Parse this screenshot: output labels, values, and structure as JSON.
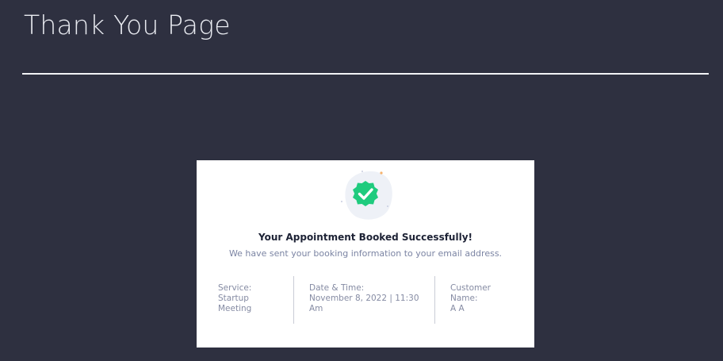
{
  "header": {
    "title": "Thank You Page"
  },
  "confirmation": {
    "icon": "check-badge-icon",
    "heading": "Your Appointment Booked Successfully!",
    "message": "We have sent your booking information to your email address.",
    "details": {
      "service_label": "Service:",
      "service_value": "Startup Meeting",
      "datetime_label": "Date & Time:",
      "datetime_value": "November 8, 2022 | 11:30 Am",
      "customer_label": "Customer Name:",
      "customer_value": "A A"
    }
  },
  "colors": {
    "background": "#2e3040",
    "card": "#ffffff",
    "success": "#1fcb7e",
    "heading_text": "#1d2235",
    "muted_text": "#7b84a3"
  }
}
